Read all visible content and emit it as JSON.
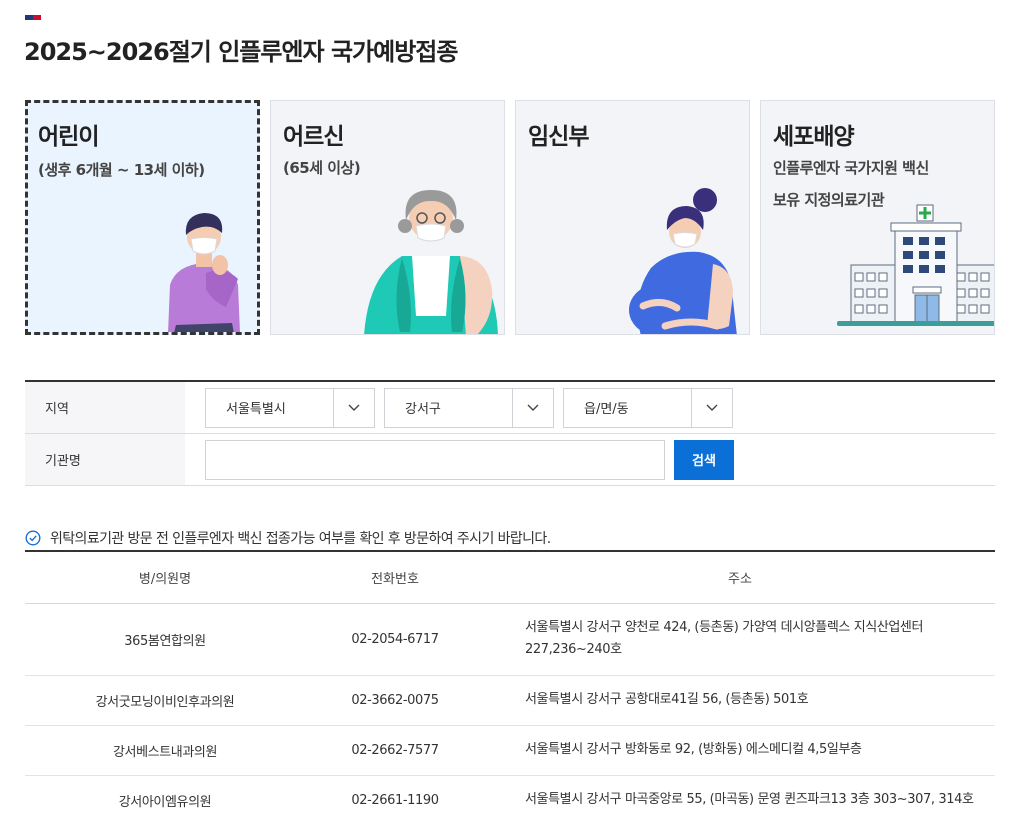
{
  "flag_colors": [
    "#1e3a7b",
    "#c8102e"
  ],
  "page_title": "2025~2026절기 인플루엔자 국가예방접종",
  "cards": [
    {
      "title": "어린이",
      "sub": "(생후 6개월 ~ 13세 이하)",
      "active": true,
      "icon": "child-illustration"
    },
    {
      "title": "어르신",
      "sub": "(65세 이상)",
      "active": false,
      "icon": "elderly-illustration"
    },
    {
      "title": "임신부",
      "sub": "",
      "active": false,
      "icon": "pregnant-illustration"
    },
    {
      "title": "세포배양",
      "sub": "인플루엔자 국가지원 백신",
      "sub2": "보유 지정의료기관",
      "active": false,
      "icon": "hospital-illustration"
    }
  ],
  "search": {
    "region_label": "지역",
    "institution_label": "기관명",
    "city_value": "서울특별시",
    "district_value": "강서구",
    "town_value": "읍/면/동",
    "institution_placeholder": "",
    "search_button": "검색"
  },
  "notice": "위탁의료기관 방문 전 인플루엔자 백신 접종가능 여부를 확인 후 방문하여 주시기 바랍니다.",
  "table": {
    "headers": [
      "병/의원명",
      "전화번호",
      "주소"
    ],
    "rows": [
      {
        "name": "365봄연합의원",
        "phone": "02-2054-6717",
        "address": "서울특별시 강서구 양천로 424, (등촌동) 가양역 데시앙플렉스 지식산업센터 227,236~240호"
      },
      {
        "name": "강서굿모닝이비인후과의원",
        "phone": "02-3662-0075",
        "address": "서울특별시 강서구 공항대로41길 56, (등촌동) 501호"
      },
      {
        "name": "강서베스트내과의원",
        "phone": "02-2662-7577",
        "address": "서울특별시 강서구 방화동로 92, (방화동) 에스메디컬 4,5일부층"
      },
      {
        "name": "강서아이엠유의원",
        "phone": "02-2661-1190",
        "address": "서울특별시 강서구 마곡중앙로 55, (마곡동) 문영 퀸즈파크13 3층 303~307, 314호"
      }
    ]
  }
}
